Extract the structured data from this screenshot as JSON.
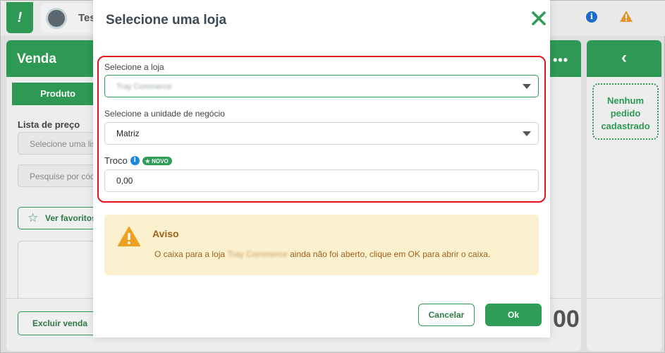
{
  "background": {
    "store_name": "Tes",
    "venda_title": "Venda",
    "dots": "•••",
    "produto_tab": "Produto",
    "lista_label": "Lista de preço",
    "lista_placeholder": "Selecione uma lis",
    "search_placeholder": "Pesquise por cód",
    "favoritos_label": "Ver favoritos",
    "excluir_label": "Excluir venda",
    "total_fragment": "00",
    "nenhum_pedido": "Nenhum pedido cadastrado",
    "back_chevron": "‹"
  },
  "modal": {
    "title": "Selecione uma loja",
    "loja_label": "Selecione a loja",
    "loja_value": "Tray Commerce",
    "unidade_label": "Selecione a unidade de negócio",
    "unidade_value": "Matriz",
    "troco_label": "Troco",
    "novo_badge": "★ NOVO",
    "troco_value": "0,00",
    "alert": {
      "title": "Aviso",
      "msg_prefix": "O caixa para a loja",
      "msg_store": "Tray Commerce",
      "msg_suffix": "ainda não foi aberto, clique em OK para abrir o caixa."
    },
    "cancel_label": "Cancelar",
    "ok_label": "Ok"
  },
  "colors": {
    "brand_green": "#2f9d57",
    "highlight_red": "#e0161c",
    "alert_bg": "#fcf1cf",
    "alert_text": "#a0611a"
  },
  "icons": [
    "logo-icon",
    "info-icon",
    "warning-icon",
    "chevron-left-icon",
    "star-icon",
    "close-icon",
    "caret-down-icon"
  ]
}
